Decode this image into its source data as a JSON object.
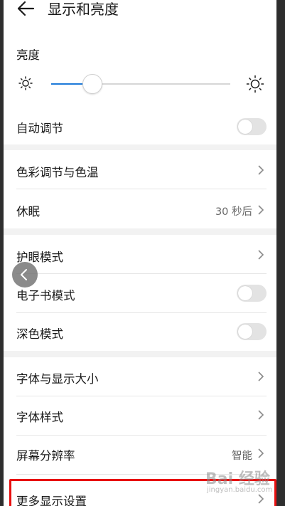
{
  "header": {
    "title": "显示和亮度",
    "back_icon": "arrow-left-icon"
  },
  "brightness": {
    "label": "亮度",
    "level": 0.23,
    "low_icon": "sun-small-icon",
    "high_icon": "sun-large-icon",
    "accent_color": "#1e7ad9"
  },
  "auto_adjust": {
    "label": "自动调节",
    "enabled": false
  },
  "color_temp": {
    "label": "色彩调节与色温"
  },
  "sleep": {
    "label": "休眠",
    "value": "30 秒后"
  },
  "eye_comfort": {
    "label": "护眼模式"
  },
  "ebook_mode": {
    "label": "电子书模式",
    "enabled": false
  },
  "dark_mode": {
    "label": "深色模式",
    "enabled": false
  },
  "font_size": {
    "label": "字体与显示大小"
  },
  "font_style": {
    "label": "字体样式"
  },
  "resolution": {
    "label": "屏幕分辨率",
    "value": "智能"
  },
  "more_settings": {
    "label": "更多显示设置",
    "highlight_color": "#e81010"
  },
  "watermark": {
    "text": "Bai 经验",
    "sub": "jingyan.baidu.com"
  }
}
